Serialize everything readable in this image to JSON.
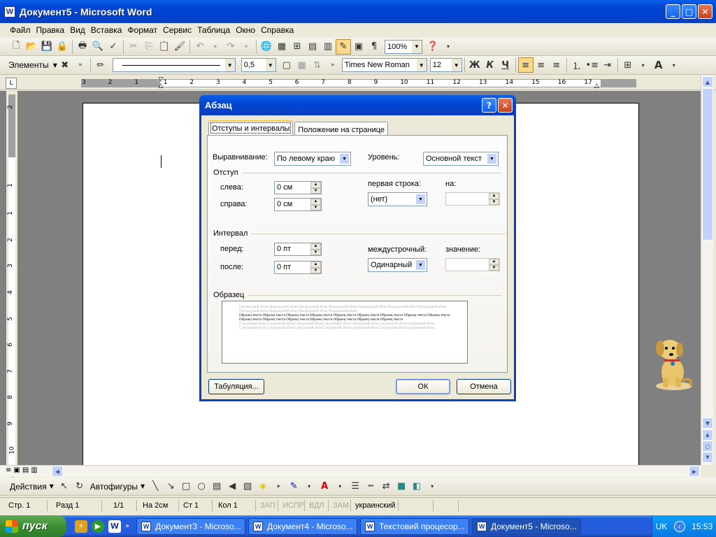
{
  "window": {
    "title": "Документ5 - Microsoft Word",
    "app_icon": "W"
  },
  "menu": [
    "Файл",
    "Правка",
    "Вид",
    "Вставка",
    "Формат",
    "Сервис",
    "Таблица",
    "Окно",
    "Справка"
  ],
  "standard_toolbar": {
    "zoom": "100%"
  },
  "formatting_toolbar": {
    "styles_label": "Элементы",
    "line_width": "0,5",
    "font": "Times New Roman",
    "size": "12",
    "bold": "Ж",
    "italic": "К",
    "underline": "Ч"
  },
  "ruler": {
    "labels": [
      "3",
      "2",
      "1",
      "1",
      "2",
      "3",
      "4",
      "5",
      "6",
      "7",
      "8",
      "9",
      "10",
      "11",
      "12",
      "13",
      "14",
      "15",
      "16",
      "17"
    ]
  },
  "vruler": {
    "labels": [
      "2",
      "1",
      "1",
      "2",
      "3",
      "4",
      "5",
      "6",
      "7",
      "8",
      "9",
      "10",
      "11"
    ]
  },
  "dialog": {
    "title": "Абзац",
    "help_button": "?",
    "tabs": [
      "Отступы и интервалы",
      "Положение на странице"
    ],
    "alignment_label": "Выравнивание:",
    "alignment_value": "По левому краю",
    "level_label": "Уровень:",
    "level_value": "Основной текст",
    "indent_group": "Отступ",
    "left_label": "слева:",
    "left_value": "0 см",
    "right_label": "справа:",
    "right_value": "0 см",
    "first_line_label": "первая строка:",
    "first_line_value": "(нет)",
    "by_label": "на:",
    "by_value": "",
    "spacing_group": "Интервал",
    "before_label": "перед:",
    "before_value": "0 пт",
    "after_label": "после:",
    "after_value": "0 пт",
    "line_spacing_label": "междустрочный:",
    "line_spacing_value": "Одинарный",
    "at_label": "значение:",
    "at_value": "",
    "sample_group": "Образец",
    "sample_prev": "Предыдущий абзац Предыдущий абзац Предыдущий абзац Предыдущий абзац Предыдущий абзац Предыдущий абзац Предыдущий абзац Предыдущий абзац Предыдущий абзац Предыдущий абзац Предыдущий абзац",
    "sample_text": "Образец текста Образец текста Образец текста Образец текста Образец текста Образец текста Образец текста Образец текста Образец текста Образец текста Образец текста Образец текста Образец текста Образец текста Образец текста Образец текста",
    "sample_next": "Следующий абзац Следующий абзац Следующий абзац Следующий абзац Следующий абзац Следующий абзац Следующий абзац Следующий абзац Следующий абзац Следующий абзац Следующий абзац Следующий абзац Следующий абзац Следующий абзац",
    "tabs_button": "Табуляция...",
    "ok_button": "ОК",
    "cancel_button": "Отмена"
  },
  "drawing_toolbar": {
    "actions": "Действия",
    "autoshapes": "Автофигуры"
  },
  "status": {
    "page": "Стр. 1",
    "section": "Разд 1",
    "pages": "1/1",
    "at": "На 2см",
    "line": "Ст 1",
    "col": "Кол 1",
    "rec": "ЗАП",
    "trk": "ИСПР",
    "ext": "ВДЛ",
    "ovr": "ЗАМ",
    "lang": "украинский"
  },
  "taskbar": {
    "start": "пуск",
    "tasks": [
      "Документ3 - Microso...",
      "Документ4 - Microso...",
      "Текстовий процесор...",
      "Документ5 - Microso..."
    ],
    "lang": "UK",
    "time": "15:53"
  },
  "colors": {
    "xp_blue": "#0046d5",
    "start_green": "#3c8f34",
    "dialog_bg": "#ece9d8"
  }
}
